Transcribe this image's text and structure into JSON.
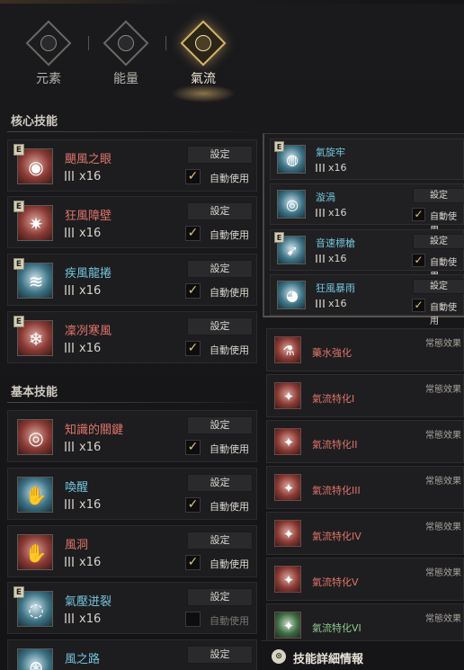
{
  "tabs": [
    {
      "label": "元素",
      "active": false,
      "icon": "element-icon"
    },
    {
      "label": "能量",
      "active": false,
      "icon": "energy-icon"
    },
    {
      "label": "氣流",
      "active": true,
      "icon": "airflow-icon"
    }
  ],
  "sections": {
    "core": "核心技能",
    "basic": "基本技能"
  },
  "common": {
    "set": "設定",
    "auto": "自動使用",
    "badge": "E",
    "passive": "常態效果",
    "count_prefix": "x"
  },
  "core_skills": [
    {
      "name": "颶風之眼",
      "count": "x16",
      "auto": true,
      "badge": true,
      "color": "red",
      "icon": "eye-storm-icon"
    },
    {
      "name": "狂風障壁",
      "count": "x16",
      "auto": true,
      "badge": true,
      "color": "red",
      "icon": "wind-barrier-icon"
    },
    {
      "name": "疾風龍捲",
      "count": "x16",
      "auto": true,
      "badge": true,
      "color": "blue",
      "icon": "tornado-icon"
    },
    {
      "name": "凜冽寒風",
      "count": "x16",
      "auto": true,
      "badge": true,
      "color": "red",
      "icon": "cold-wind-icon"
    }
  ],
  "basic_skills": [
    {
      "name": "知識的關鍵",
      "count": "x16",
      "auto": true,
      "badge": false,
      "color": "red",
      "icon": "eye-of-knowledge-icon"
    },
    {
      "name": "喚醒",
      "count": "x16",
      "auto": true,
      "badge": false,
      "color": "blue",
      "icon": "awaken-hand-icon"
    },
    {
      "name": "風洞",
      "count": "x16",
      "auto": true,
      "badge": false,
      "color": "red",
      "icon": "wind-cave-icon"
    },
    {
      "name": "氣壓迸裂",
      "count": "x16",
      "auto": false,
      "badge": true,
      "color": "blue",
      "icon": "pressure-burst-icon"
    },
    {
      "name": "風之路",
      "count": "",
      "auto": false,
      "badge": false,
      "color": "blue",
      "icon": "wind-path-icon"
    }
  ],
  "right_skills": [
    {
      "name": "氣旋牢",
      "count": "x16",
      "badge": true,
      "color": "blue",
      "icon": "cyclone-prison-icon",
      "has_controls": false
    },
    {
      "name": "漩渦",
      "count": "x16",
      "auto": true,
      "badge": false,
      "color": "blue",
      "icon": "vortex-icon",
      "has_controls": true
    },
    {
      "name": "音速標槍",
      "count": "x16",
      "auto": true,
      "badge": true,
      "color": "blue",
      "icon": "sonic-spear-icon",
      "has_controls": true
    },
    {
      "name": "狂風暴雨",
      "count": "x16",
      "auto": true,
      "badge": false,
      "color": "blue",
      "icon": "storm-rain-icon",
      "has_controls": true
    }
  ],
  "passives": [
    {
      "name": "藥水強化",
      "color": "red",
      "icon": "potion-icon"
    },
    {
      "name": "氣流特化I",
      "color": "red",
      "icon": "airflow-spec-icon"
    },
    {
      "name": "氣流特化II",
      "color": "red",
      "icon": "airflow-spec-icon"
    },
    {
      "name": "氣流特化III",
      "color": "red",
      "icon": "airflow-spec-icon"
    },
    {
      "name": "氣流特化IV",
      "color": "red",
      "icon": "airflow-spec-icon"
    },
    {
      "name": "氣流特化V",
      "color": "red",
      "icon": "airflow-spec-icon"
    },
    {
      "name": "氣流特化VI",
      "color": "green",
      "icon": "airflow-spec-icon"
    }
  ],
  "footer": {
    "label": "技能詳細情報",
    "icon": "info-icon"
  }
}
